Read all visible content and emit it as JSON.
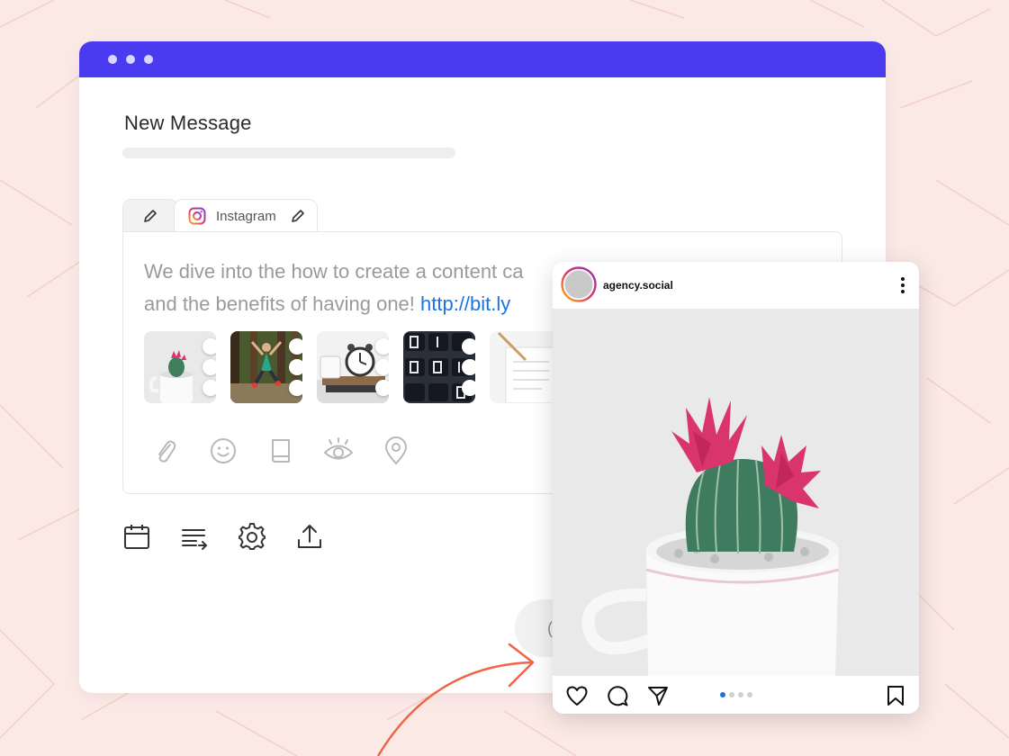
{
  "window": {
    "title": "New Message",
    "accent_color": "#4b3bf0"
  },
  "tabs": [
    {
      "icon": "pencil-icon"
    },
    {
      "icon": "instagram-icon",
      "label": "Instagram",
      "edit_icon": "pencil-icon"
    }
  ],
  "editor": {
    "text_line1": "We dive into the how to create a content ca",
    "text_line2": "and the benefits of having one! ",
    "link": "http://bit.ly",
    "thumbnails": [
      "cactus-photo",
      "jumping-person-photo",
      "alarm-clock-photo",
      "flip-clock-photo",
      "notebook-photo"
    ],
    "icons": [
      "paperclip-icon",
      "emoji-icon",
      "book-icon",
      "eye-icon",
      "location-pin-icon"
    ]
  },
  "toolbar": {
    "icons": [
      "calendar-icon",
      "text-format-icon",
      "gear-icon",
      "upload-icon"
    ]
  },
  "send_button": {
    "label": "("
  },
  "preview": {
    "username": "agency.social",
    "icons": [
      "heart-icon",
      "comment-icon",
      "share-icon",
      "bookmark-icon"
    ],
    "pager": {
      "count": 4,
      "active": 0
    },
    "link_color": "#1a73e8"
  }
}
